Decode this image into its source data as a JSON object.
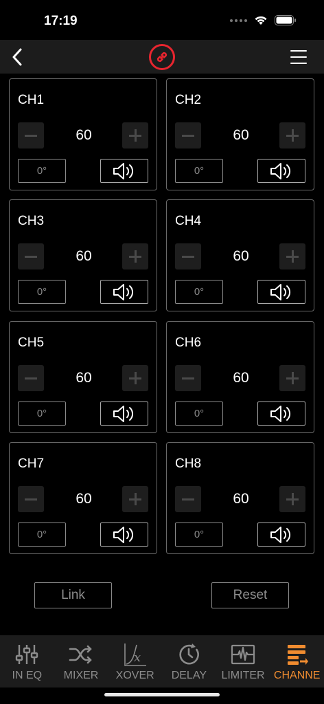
{
  "status_bar": {
    "time": "17:19"
  },
  "nav": {
    "back_icon": "chevron-left-icon",
    "link_icon": "link-icon",
    "menu_icon": "hamburger-menu-icon",
    "accent_color": "#e8252f"
  },
  "channels": [
    {
      "name": "CH1",
      "volume": "60",
      "phase": "0°"
    },
    {
      "name": "CH2",
      "volume": "60",
      "phase": "0°"
    },
    {
      "name": "CH3",
      "volume": "60",
      "phase": "0°"
    },
    {
      "name": "CH4",
      "volume": "60",
      "phase": "0°"
    },
    {
      "name": "CH5",
      "volume": "60",
      "phase": "0°"
    },
    {
      "name": "CH6",
      "volume": "60",
      "phase": "0°"
    },
    {
      "name": "CH7",
      "volume": "60",
      "phase": "0°"
    },
    {
      "name": "CH8",
      "volume": "60",
      "phase": "0°"
    }
  ],
  "actions": {
    "link_label": "Link",
    "reset_label": "Reset"
  },
  "tabs": [
    {
      "label": "IN EQ",
      "icon": "equalizer-sliders-icon",
      "active": false
    },
    {
      "label": "MIXER",
      "icon": "shuffle-icon",
      "active": false
    },
    {
      "label": "XOVER",
      "icon": "crossover-curve-icon",
      "active": false
    },
    {
      "label": "DELAY",
      "icon": "clock-icon",
      "active": false
    },
    {
      "label": "LIMITER",
      "icon": "waveform-icon",
      "active": false
    },
    {
      "label": "CHANNE",
      "icon": "channel-list-icon",
      "active": true
    }
  ],
  "colors": {
    "active_tab": "#f08c30",
    "inactive_tab": "#8c8c8c"
  }
}
